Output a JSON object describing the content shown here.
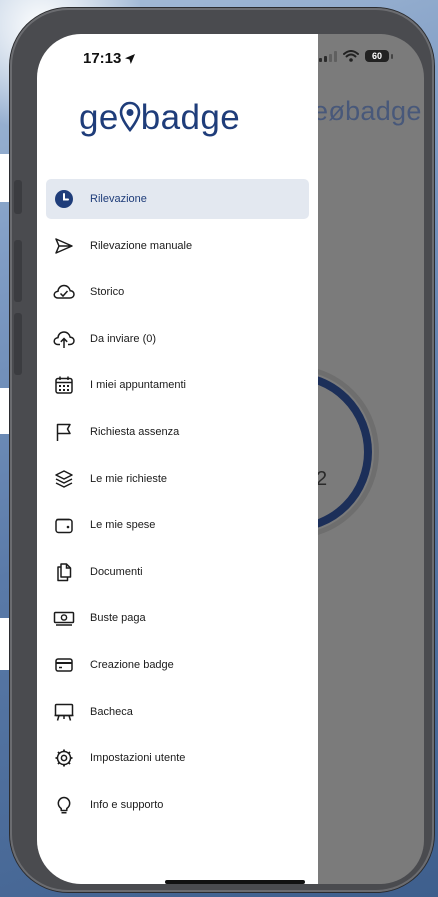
{
  "status_bar": {
    "time": "17:13",
    "battery": "60"
  },
  "app": {
    "logo_prefix": "ge",
    "logo_suffix": "badge",
    "under_logo": "eøbadge",
    "under_counter": "2"
  },
  "menu": {
    "items": [
      {
        "label": "Rilevazione",
        "icon": "clock-icon",
        "active": true
      },
      {
        "label": "Rilevazione manuale",
        "icon": "send-icon",
        "active": false
      },
      {
        "label": "Storico",
        "icon": "cloud-check-icon",
        "active": false
      },
      {
        "label": "Da inviare (0)",
        "icon": "cloud-upload-icon",
        "active": false
      },
      {
        "label": "I miei appuntamenti",
        "icon": "calendar-icon",
        "active": false
      },
      {
        "label": "Richiesta assenza",
        "icon": "flag-icon",
        "active": false
      },
      {
        "label": "Le mie richieste",
        "icon": "layers-icon",
        "active": false
      },
      {
        "label": "Le mie spese",
        "icon": "wallet-icon",
        "active": false
      },
      {
        "label": "Documenti",
        "icon": "documents-icon",
        "active": false
      },
      {
        "label": "Buste paga",
        "icon": "banknote-icon",
        "active": false
      },
      {
        "label": "Creazione badge",
        "icon": "credit-card-icon",
        "active": false
      },
      {
        "label": "Bacheca",
        "icon": "easel-icon",
        "active": false
      },
      {
        "label": "Impostazioni utente",
        "icon": "gear-icon",
        "active": false
      },
      {
        "label": "Info e supporto",
        "icon": "lightbulb-icon",
        "active": false
      }
    ]
  },
  "colors": {
    "brand": "#1f3d7a",
    "active_bg": "#e3e8f0",
    "overlay": "#7b7b7b"
  }
}
